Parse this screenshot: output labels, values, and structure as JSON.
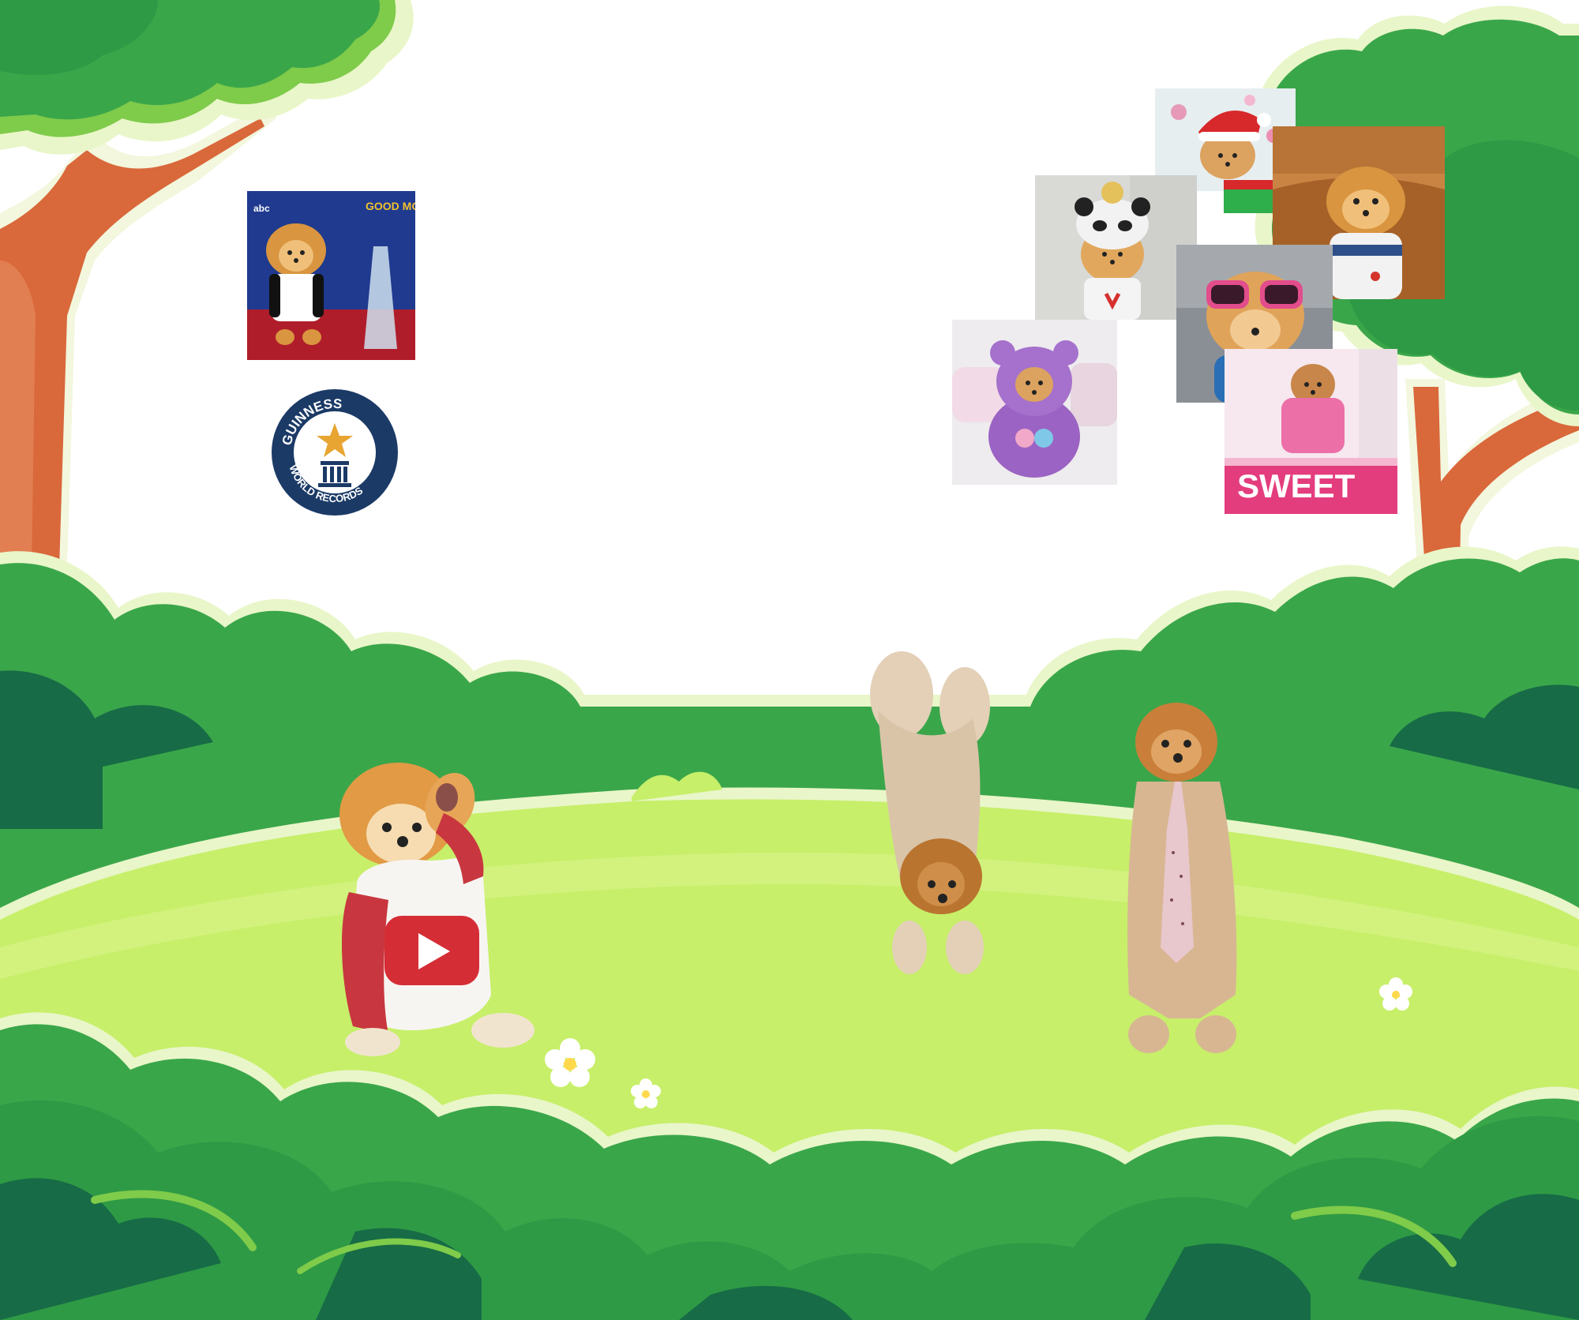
{
  "colors": {
    "canopy_light": "#3aa64a",
    "canopy_mid": "#2e9a45",
    "canopy_dark": "#176b46",
    "outline_pale": "#e9f6c9",
    "meadow": "#c7ef6a",
    "meadow_light": "#d8f48a",
    "trunk": "#d9683b",
    "trunk_shadow": "#b9532d"
  },
  "photos": {
    "gma": {
      "title_text": "GOOD MORNING AMERICA",
      "network_logo": "abc"
    },
    "guinness": {
      "ring_top": "GUINNESS",
      "ring_bottom": "WORLD RECORDS"
    },
    "sweet": {
      "text": "SWEET"
    }
  },
  "icons": [
    "youtube-play-icon",
    "star-icon",
    "flower-icon"
  ]
}
